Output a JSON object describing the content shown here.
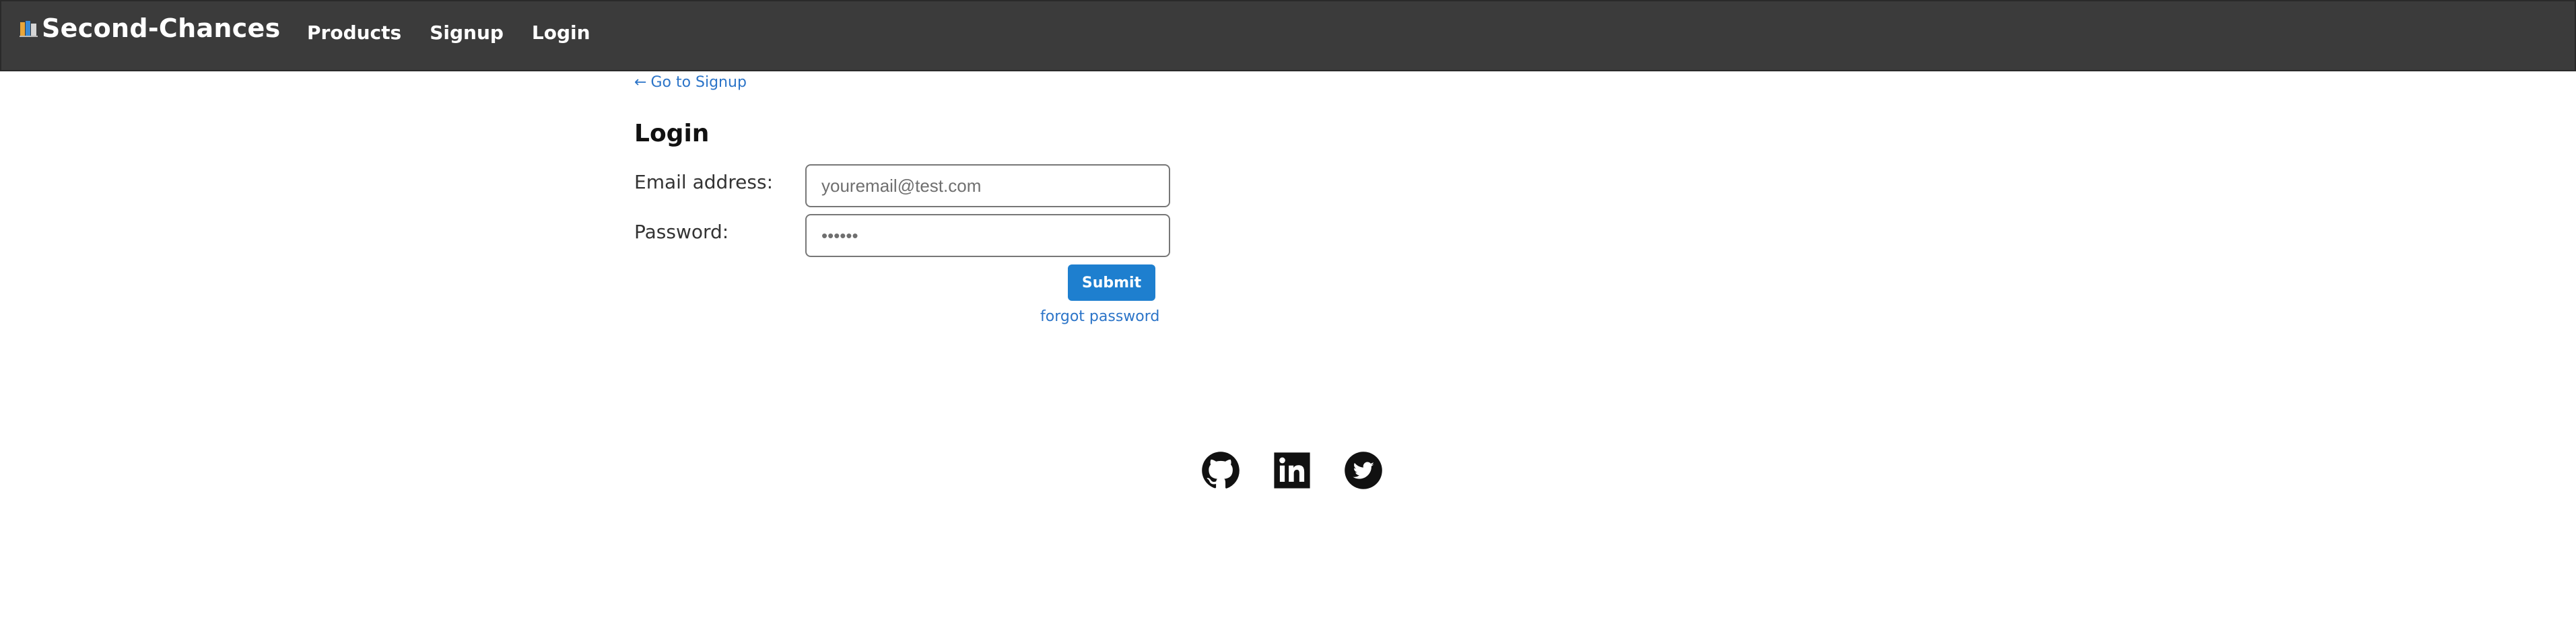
{
  "header": {
    "brand": "Second-Chances",
    "nav": [
      {
        "label": "Products"
      },
      {
        "label": "Signup"
      },
      {
        "label": "Login"
      }
    ]
  },
  "back_link": {
    "arrow": "←",
    "label": "Go to Signup"
  },
  "login_form": {
    "title": "Login",
    "email": {
      "label": "Email address:",
      "placeholder": "youremail@test.com",
      "value": ""
    },
    "password": {
      "label": "Password:",
      "placeholder": "••••••",
      "value": ""
    },
    "submit_label": "Submit",
    "forgot_label": "forgot password"
  },
  "footer": {
    "icons": [
      "github-icon",
      "linkedin-icon",
      "twitter-icon"
    ]
  },
  "colors": {
    "header_bg": "#3b3b3b",
    "link": "#2b74c8",
    "button": "#1e7fcf"
  }
}
